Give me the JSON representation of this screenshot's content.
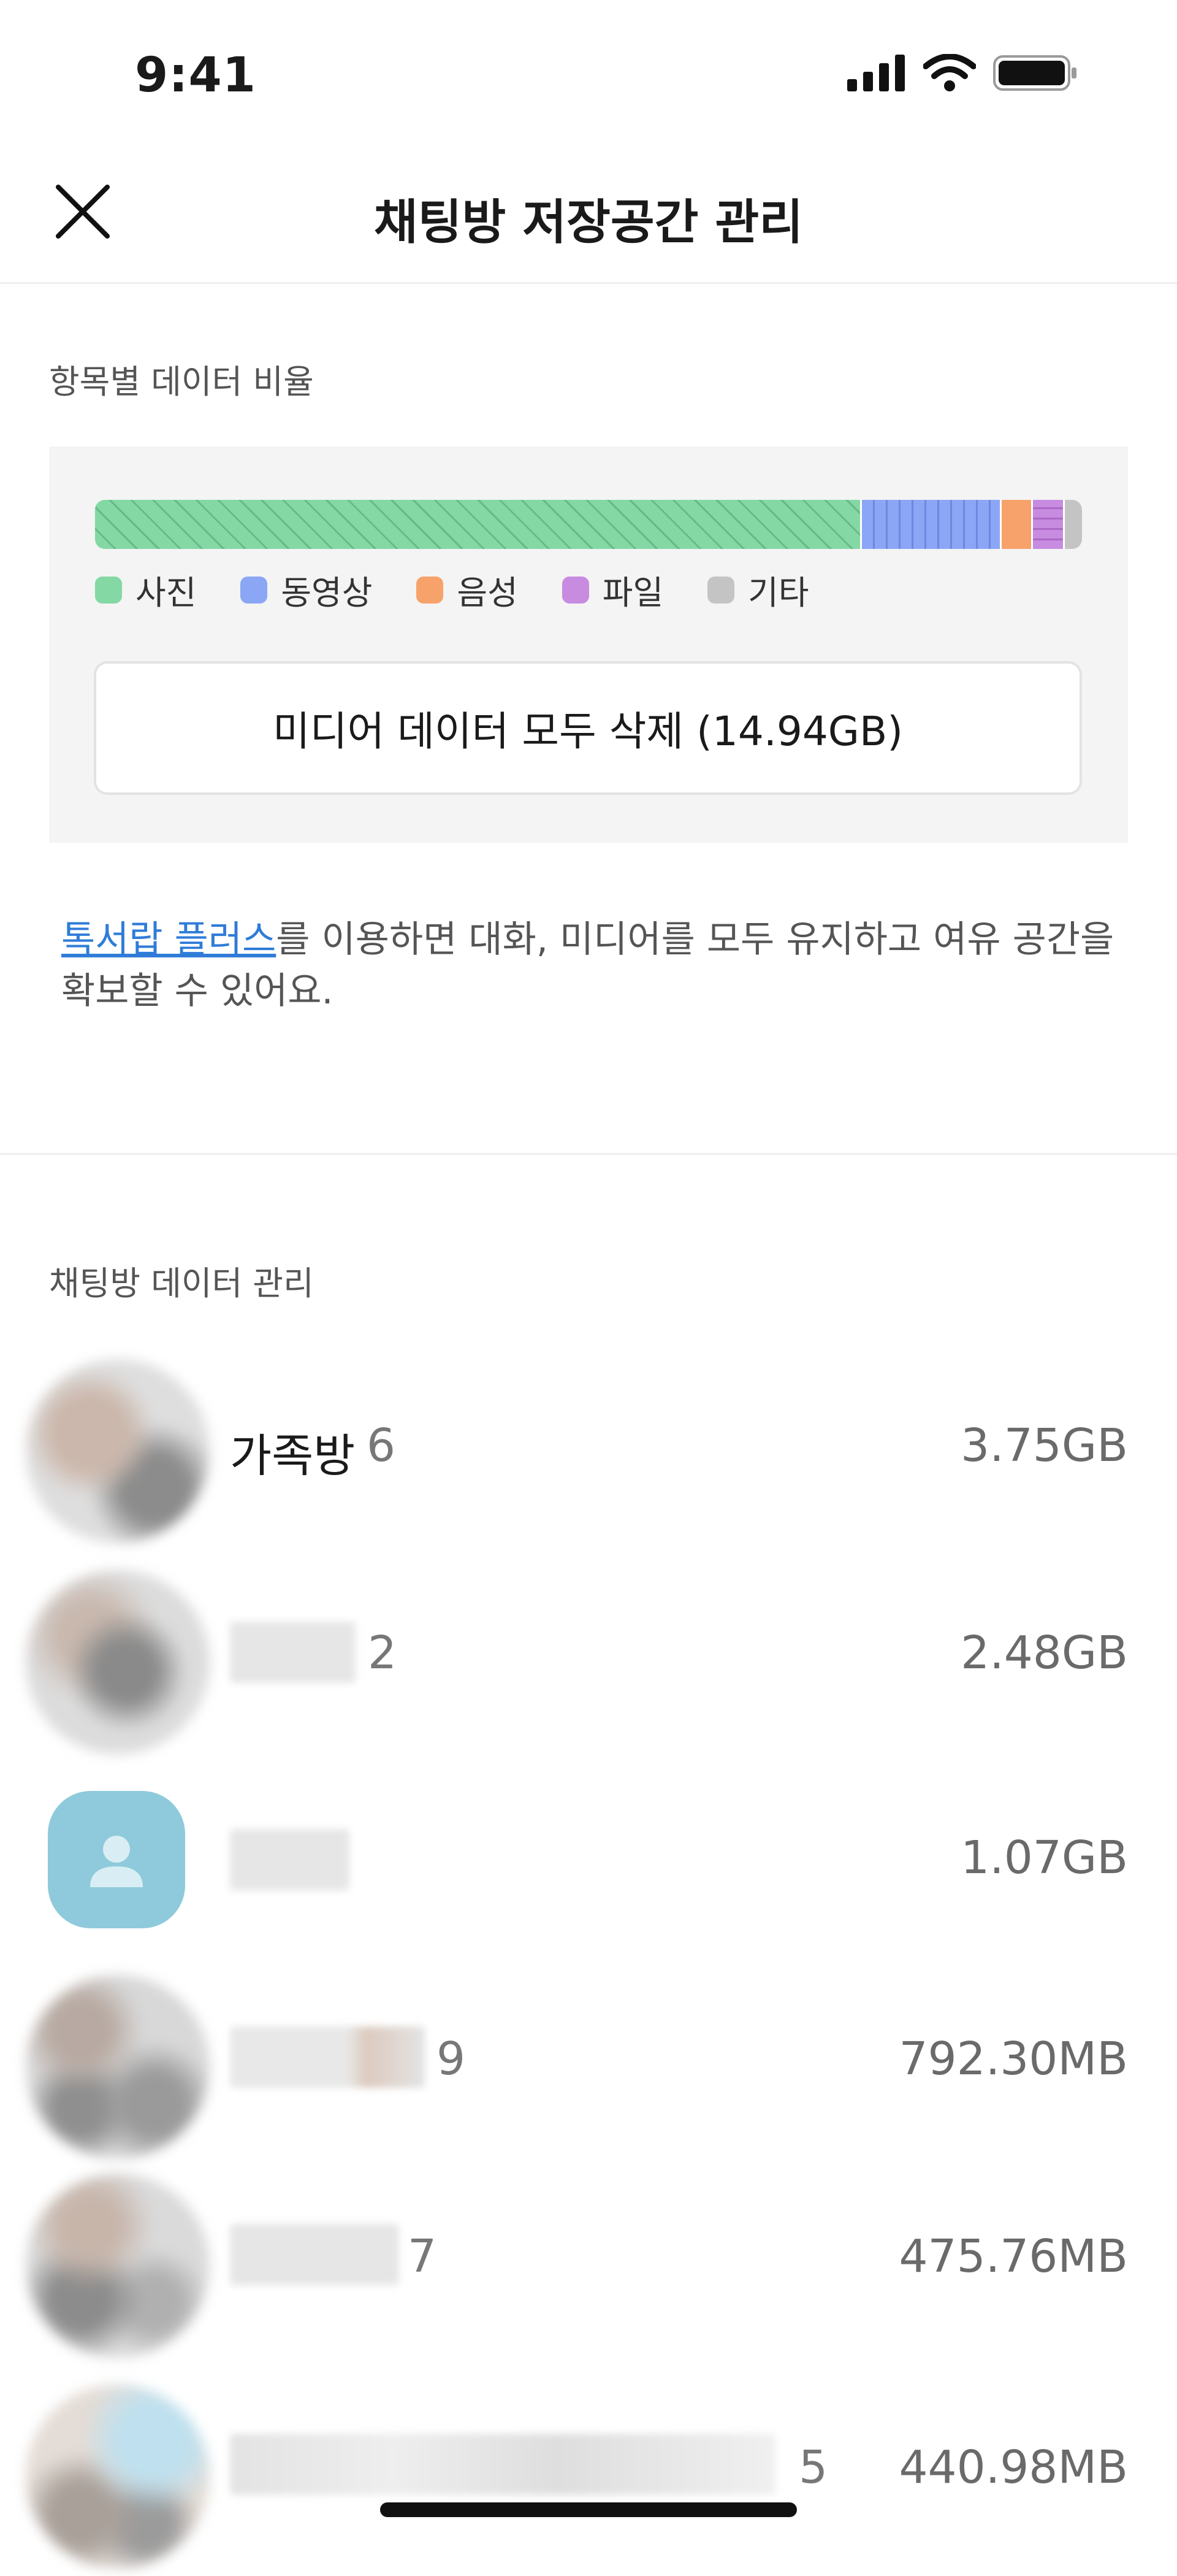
{
  "status": {
    "time": "9:41"
  },
  "header": {
    "title": "채팅방 저장공간 관리"
  },
  "ratio_section": {
    "label": "항목별 데이터 비율",
    "segments": [
      {
        "name": "사진",
        "fraction": 0.775,
        "color": "#84d8a3"
      },
      {
        "name": "동영상",
        "fraction": 0.14,
        "color": "#8aa6f5"
      },
      {
        "name": "음성",
        "fraction": 0.03,
        "color": "#f7a26a"
      },
      {
        "name": "파일",
        "fraction": 0.03,
        "color": "#c78be0"
      },
      {
        "name": "기타",
        "fraction": 0.016,
        "color": "#c4c4c4"
      }
    ],
    "legend": [
      {
        "label": "사진",
        "color": "#84d8a3"
      },
      {
        "label": "동영상",
        "color": "#8aa6f5"
      },
      {
        "label": "음성",
        "color": "#f7a26a"
      },
      {
        "label": "파일",
        "color": "#c78be0"
      },
      {
        "label": "기타",
        "color": "#c4c4c4"
      }
    ],
    "delete_button": "미디어 데이터 모두 삭제 (14.94GB)"
  },
  "promo": {
    "link_text": "톡서랍 플러스",
    "text": "를 이용하면 대화, 미디어를 모두 유지하고 여유 공간을 확보할 수 있어요."
  },
  "chat_section": {
    "label": "채팅방 데이터 관리",
    "rows": [
      {
        "name": "가족방",
        "count": "6",
        "size": "3.75GB"
      },
      {
        "name": "",
        "count": "2",
        "size": "2.48GB"
      },
      {
        "name": "",
        "count": "",
        "size": "1.07GB"
      },
      {
        "name": "",
        "count": "9",
        "size": "792.30MB"
      },
      {
        "name": "",
        "count": "7",
        "size": "475.76MB"
      },
      {
        "name": "",
        "count": "5",
        "size": "440.98MB"
      }
    ]
  }
}
